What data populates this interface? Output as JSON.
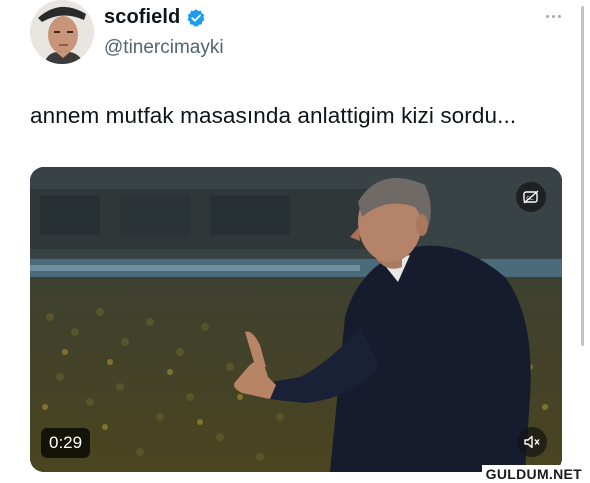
{
  "tweet": {
    "author": {
      "display_name": "scofield",
      "handle": "@tinercimayki",
      "verified": true,
      "avatar_icon": "user-avatar-photo"
    },
    "text": "annem mutfak masasında anlattigim kizi sordu...",
    "menu_icon": "more-horizontal-icon"
  },
  "video": {
    "duration": "0:29",
    "caption_icon": "closed-captions-off-icon",
    "volume_icon": "volume-muted-icon"
  },
  "watermark": "GULDUM.NET",
  "colors": {
    "verified_blue": "#1d9bf0",
    "handle_gray": "#536471",
    "text": "#0f1419"
  }
}
